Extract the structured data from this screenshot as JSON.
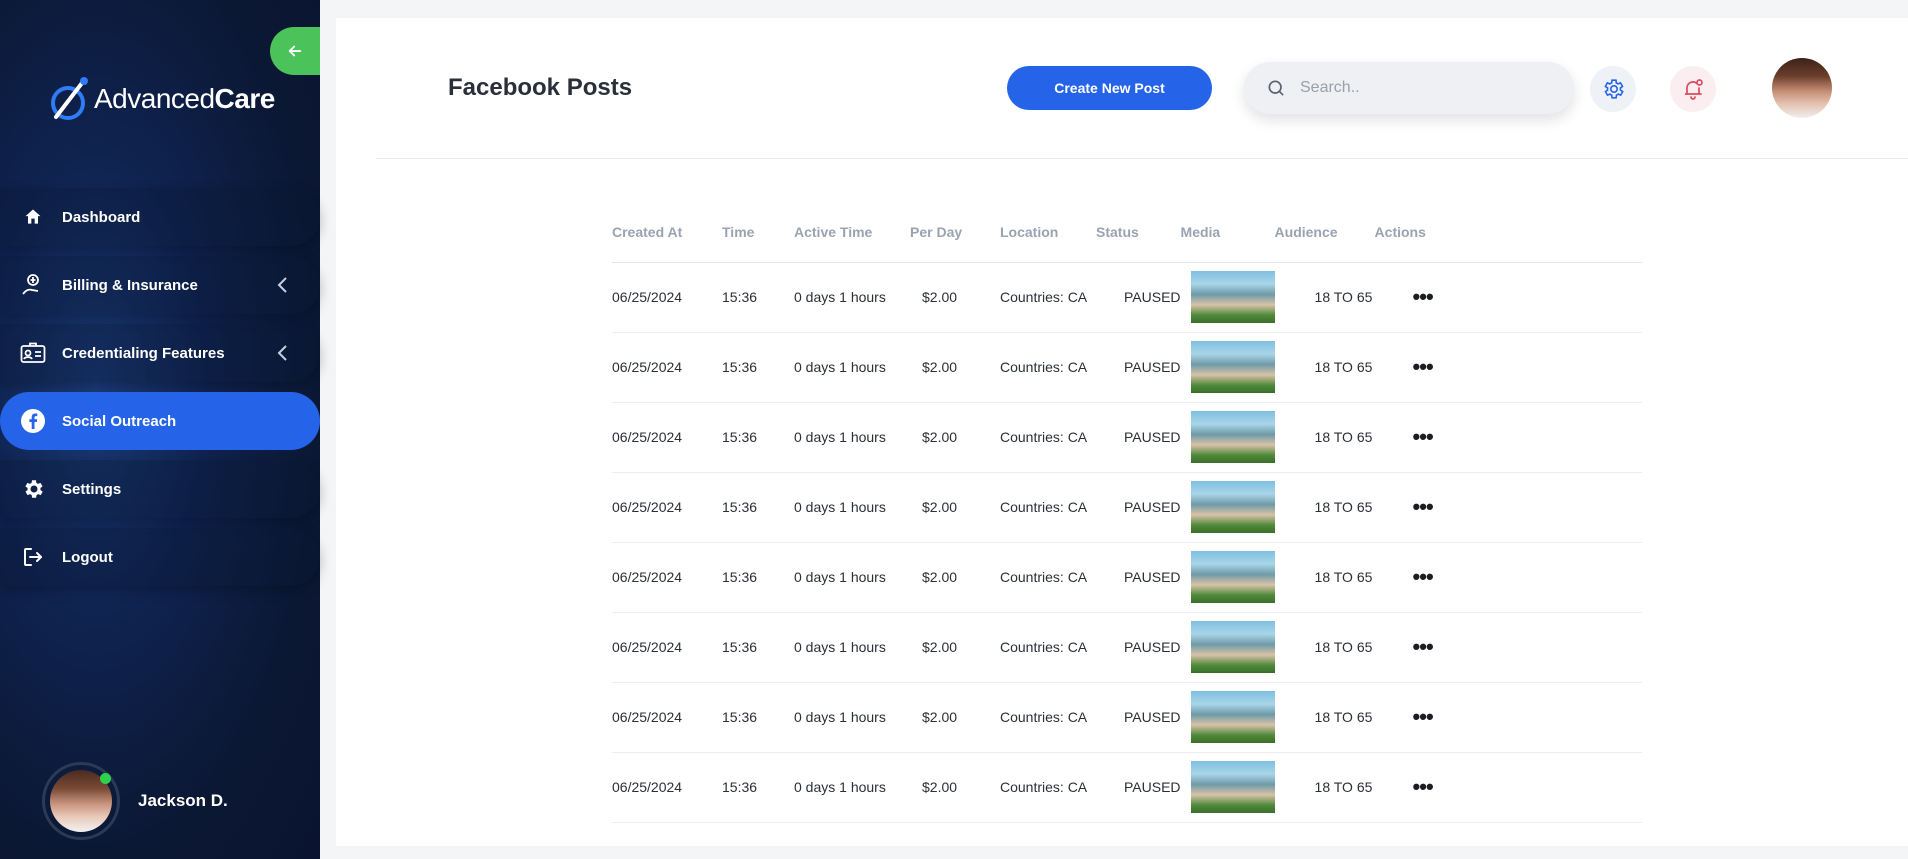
{
  "brand": {
    "name_regular": "Advanced",
    "name_bold": "Care"
  },
  "sidebar": {
    "items": [
      {
        "label": "Dashboard",
        "icon": "home-icon",
        "active": false,
        "has_chevron": false
      },
      {
        "label": "Billing & Insurance",
        "icon": "billing-icon",
        "active": false,
        "has_chevron": true
      },
      {
        "label": "Credentialing Features",
        "icon": "id-card-icon",
        "active": false,
        "has_chevron": true
      },
      {
        "label": "Social Outreach",
        "icon": "facebook-icon",
        "active": true,
        "has_chevron": false
      },
      {
        "label": "Settings",
        "icon": "gear-icon",
        "active": false,
        "has_chevron": false
      },
      {
        "label": "Logout",
        "icon": "logout-icon",
        "active": false,
        "has_chevron": false
      }
    ],
    "user": {
      "name": "Jackson D.",
      "online": true
    }
  },
  "header": {
    "title": "Facebook Posts",
    "create_button": "Create New Post",
    "search_placeholder": "Search.."
  },
  "table": {
    "columns": [
      "Created At",
      "Time",
      "Active Time",
      "Per Day",
      "Location",
      "Status",
      "Media",
      "Audience",
      "Actions"
    ],
    "rows": [
      {
        "created_at": "06/25/2024",
        "time": "15:36",
        "active_time": "0 days 1 hours",
        "per_day": "$2.00",
        "location": "Countries: CA",
        "status": "PAUSED",
        "audience": "18 TO 65"
      },
      {
        "created_at": "06/25/2024",
        "time": "15:36",
        "active_time": "0 days 1 hours",
        "per_day": "$2.00",
        "location": "Countries: CA",
        "status": "PAUSED",
        "audience": "18 TO 65"
      },
      {
        "created_at": "06/25/2024",
        "time": "15:36",
        "active_time": "0 days 1 hours",
        "per_day": "$2.00",
        "location": "Countries: CA",
        "status": "PAUSED",
        "audience": "18 TO 65"
      },
      {
        "created_at": "06/25/2024",
        "time": "15:36",
        "active_time": "0 days 1 hours",
        "per_day": "$2.00",
        "location": "Countries: CA",
        "status": "PAUSED",
        "audience": "18 TO 65"
      },
      {
        "created_at": "06/25/2024",
        "time": "15:36",
        "active_time": "0 days 1 hours",
        "per_day": "$2.00",
        "location": "Countries: CA",
        "status": "PAUSED",
        "audience": "18 TO 65"
      },
      {
        "created_at": "06/25/2024",
        "time": "15:36",
        "active_time": "0 days 1 hours",
        "per_day": "$2.00",
        "location": "Countries: CA",
        "status": "PAUSED",
        "audience": "18 TO 65"
      },
      {
        "created_at": "06/25/2024",
        "time": "15:36",
        "active_time": "0 days 1 hours",
        "per_day": "$2.00",
        "location": "Countries: CA",
        "status": "PAUSED",
        "audience": "18 TO 65"
      },
      {
        "created_at": "06/25/2024",
        "time": "15:36",
        "active_time": "0 days 1 hours",
        "per_day": "$2.00",
        "location": "Countries: CA",
        "status": "PAUSED",
        "audience": "18 TO 65"
      }
    ]
  },
  "colors": {
    "primary": "#2563e8",
    "accent_green": "#4cc35a",
    "sidebar_bg": "#0b1834",
    "notification_red": "#e04a5f"
  }
}
